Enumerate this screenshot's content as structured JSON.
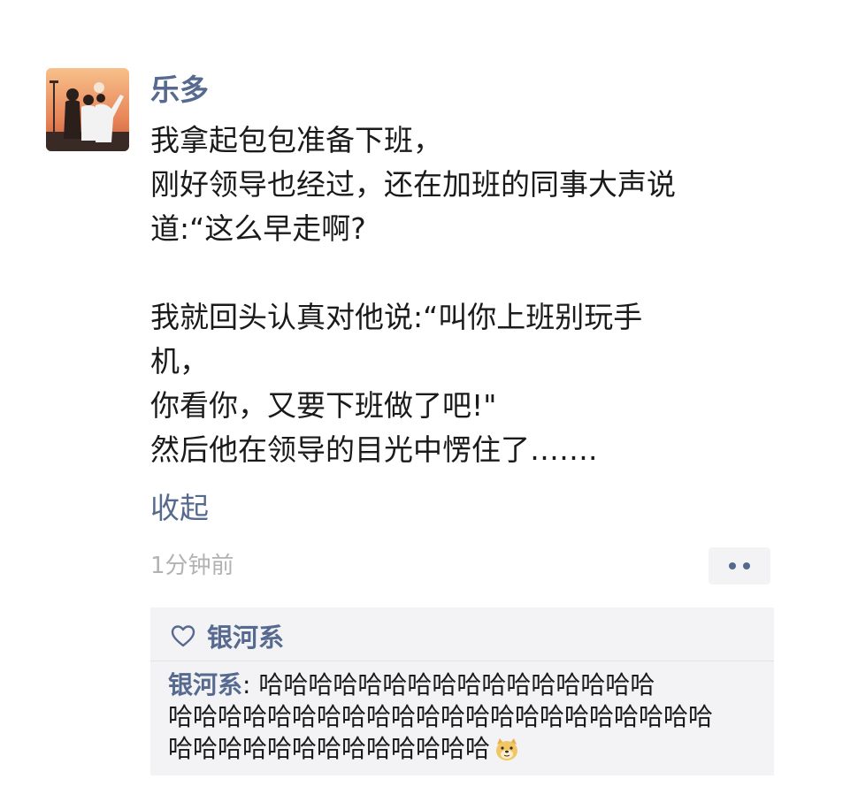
{
  "post": {
    "username": "乐多",
    "lines": [
      "我拿起包包准备下班，",
      "刚好领导也经过，还在加班的同事大声说",
      "道:“这么早走啊?",
      "",
      "我就回头认真对他说:“叫你上班别玩手",
      "机，",
      "你看你，又要下班做了吧!\"",
      "然后他在领导的目光中愣住了……."
    ],
    "collapse_label": "收起",
    "timestamp": "1分钟前"
  },
  "interactions": {
    "like_icon": "heart-outline-icon",
    "likes": "银河系",
    "comment": {
      "author": "银河系",
      "separator": ": ",
      "line1": "哈哈哈哈哈哈哈哈哈哈哈哈哈哈哈哈",
      "line2": "哈哈哈哈哈哈哈哈哈哈哈哈哈哈哈哈哈哈哈哈哈哈",
      "line3": "哈哈哈哈哈哈哈哈哈哈哈哈哈",
      "emoji": "doge-emoji-icon"
    }
  },
  "colors": {
    "name_link": "#56698f",
    "timestamp": "#b2b2b2",
    "comment_bg": "#f3f3f5"
  }
}
